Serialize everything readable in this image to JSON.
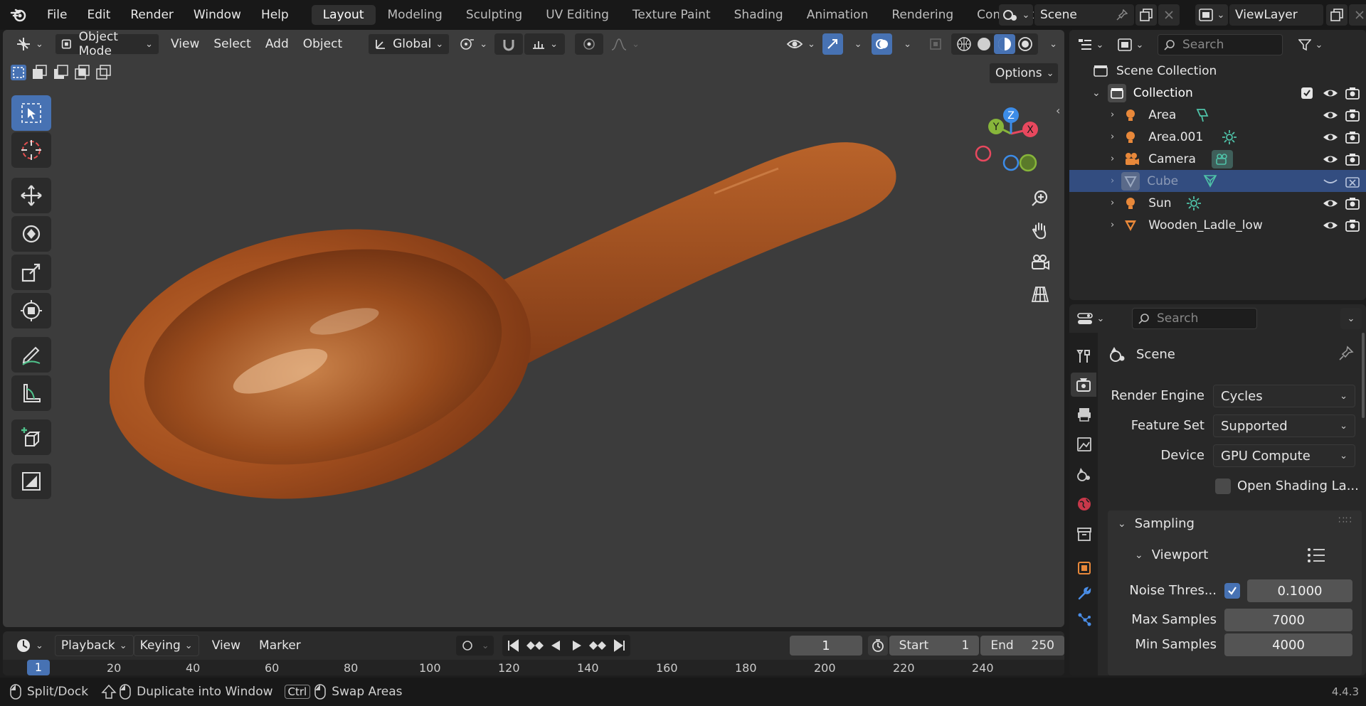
{
  "topbar": {
    "menus": [
      "File",
      "Edit",
      "Render",
      "Window",
      "Help"
    ],
    "workspaces": [
      "Layout",
      "Modeling",
      "Sculpting",
      "UV Editing",
      "Texture Paint",
      "Shading",
      "Animation",
      "Rendering",
      "Compositing"
    ],
    "active_workspace": "Layout",
    "scene_name": "Scene",
    "view_layer": "ViewLayer"
  },
  "viewport_header": {
    "mode": "Object Mode",
    "menus": [
      "View",
      "Select",
      "Add",
      "Object"
    ],
    "orientation": "Global",
    "options_label": "Options"
  },
  "gizmo": {
    "x": "X",
    "y": "Y",
    "z": "Z"
  },
  "outliner": {
    "search_placeholder": "Search",
    "root": "Scene Collection",
    "collection": "Collection",
    "items": [
      {
        "name": "Area",
        "type_icon": "area-light-icon"
      },
      {
        "name": "Area.001",
        "type_icon": "sun-light-icon"
      },
      {
        "name": "Camera",
        "type_icon": "camera-data-icon"
      },
      {
        "name": "Cube",
        "type_icon": "mesh-data-icon",
        "selected": true
      },
      {
        "name": "Sun",
        "type_icon": "sun-light-icon"
      },
      {
        "name": "Wooden_Ladle_low",
        "type_icon": "mesh-icon"
      }
    ]
  },
  "properties": {
    "search_placeholder": "Search",
    "context_title": "Scene",
    "render_engine_label": "Render Engine",
    "render_engine": "Cycles",
    "feature_set_label": "Feature Set",
    "feature_set": "Supported",
    "device_label": "Device",
    "device": "GPU Compute",
    "osl_label": "Open Shading La...",
    "sampling_label": "Sampling",
    "viewport_label": "Viewport",
    "noise_threshold_label": "Noise Thres...",
    "noise_threshold": "0.1000",
    "max_samples_label": "Max Samples",
    "max_samples": "7000",
    "min_samples_label": "Min Samples",
    "min_samples": "4000"
  },
  "timeline": {
    "menus": [
      "Playback",
      "Keying",
      "View",
      "Marker"
    ],
    "current_frame": "1",
    "start_label": "Start",
    "start": "1",
    "end_label": "End",
    "end": "250",
    "ruler_current": "1",
    "ruler_ticks": [
      "20",
      "40",
      "60",
      "80",
      "100",
      "120",
      "140",
      "160",
      "180",
      "200",
      "220",
      "240"
    ]
  },
  "statusbar": {
    "split": "Split/Dock",
    "duplicate": "Duplicate into Window",
    "ctrl": "Ctrl",
    "swap": "Swap Areas",
    "version": "4.4.3"
  },
  "colors": {
    "accent": "#4772b3",
    "selected_row": "#334d80",
    "object_orange": "#e8883a",
    "axis_x": "#e8485e",
    "axis_y": "#87b53a",
    "axis_z": "#3c8ce8"
  }
}
